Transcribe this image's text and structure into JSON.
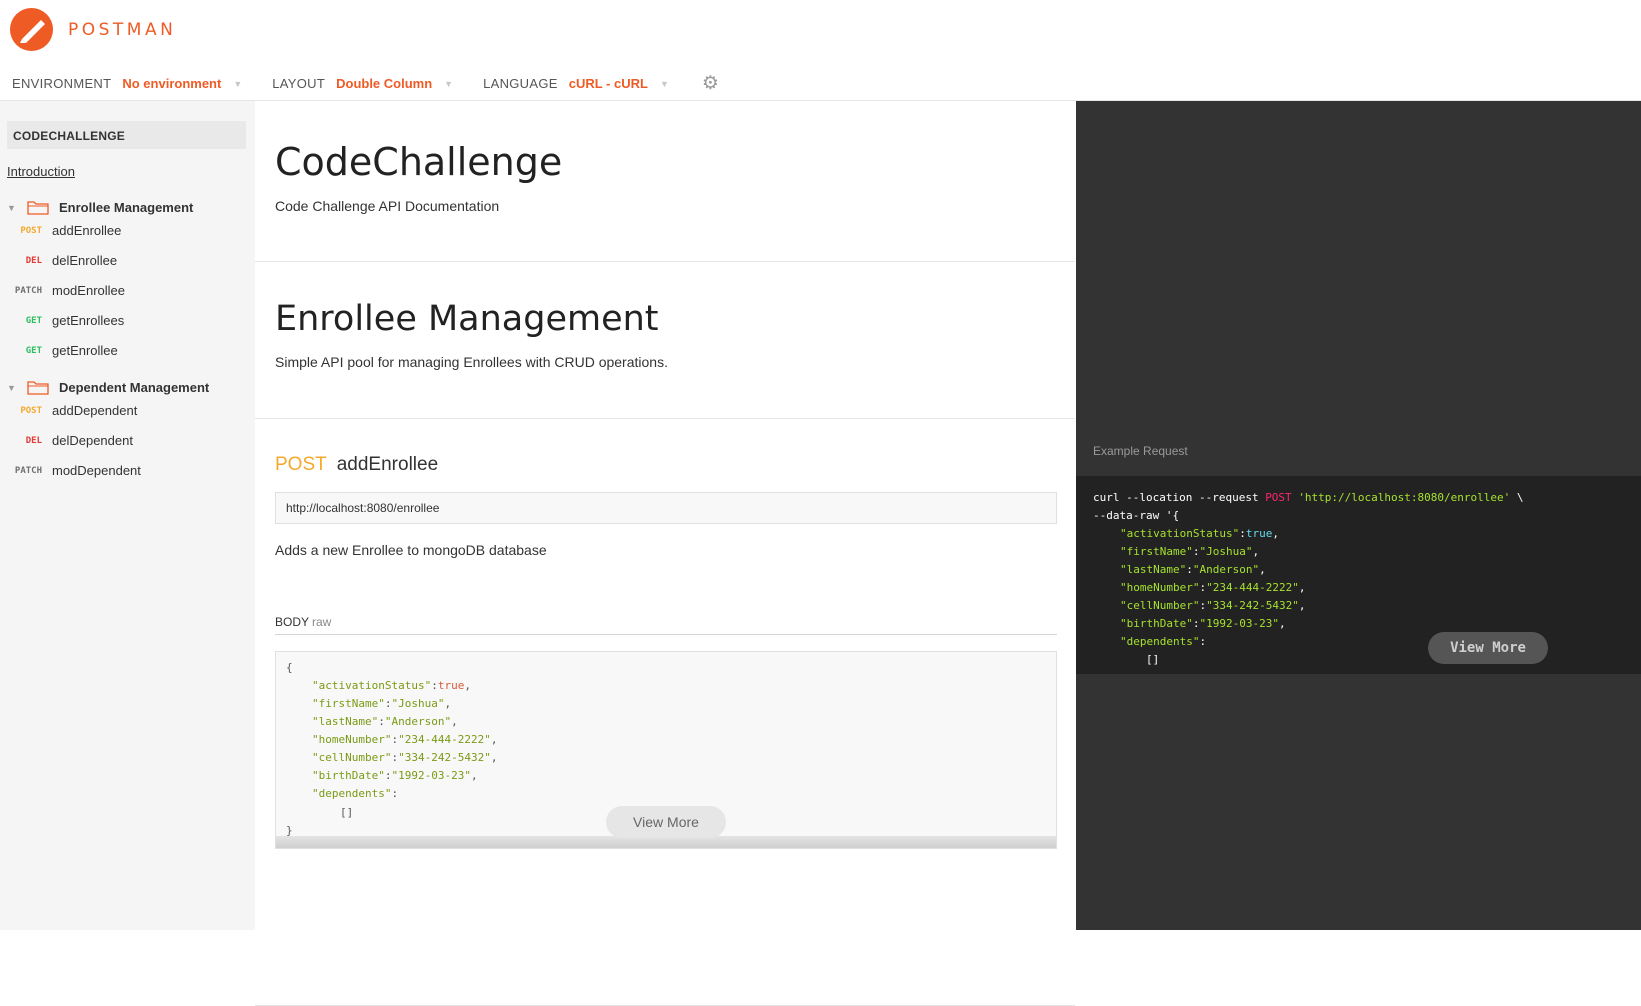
{
  "brand": {
    "name": "POSTMAN",
    "color": "#ef5b25"
  },
  "controls": {
    "environment": {
      "label": "ENVIRONMENT",
      "value": "No environment"
    },
    "layout": {
      "label": "LAYOUT",
      "value": "Double Column"
    },
    "language": {
      "label": "LANGUAGE",
      "value": "cURL - cURL"
    },
    "settings_icon": "gear-icon"
  },
  "sidebar": {
    "collection": "CODECHALLENGE",
    "intro": "Introduction",
    "folders": [
      {
        "name": "Enrollee Management",
        "requests": [
          {
            "method": "POST",
            "name": "addEnrollee"
          },
          {
            "method": "DEL",
            "name": "delEnrollee"
          },
          {
            "method": "PATCH",
            "name": "modEnrollee"
          },
          {
            "method": "GET",
            "name": "getEnrollees"
          },
          {
            "method": "GET",
            "name": "getEnrollee"
          }
        ]
      },
      {
        "name": "Dependent Management",
        "requests": [
          {
            "method": "POST",
            "name": "addDependent"
          },
          {
            "method": "DEL",
            "name": "delDependent"
          },
          {
            "method": "PATCH",
            "name": "modDependent"
          }
        ]
      }
    ]
  },
  "main": {
    "title": "CodeChallenge",
    "subtitle": "Code Challenge API Documentation",
    "folder_title": "Enrollee Management",
    "folder_desc": "Simple API pool for managing Enrollees with CRUD operations.",
    "request": {
      "method": "POST",
      "name": "addEnrollee",
      "url": "http://localhost:8080/enrollee",
      "description": "Adds a new Enrollee to mongoDB database",
      "body_label": "BODY",
      "body_mode": "raw",
      "view_more": "View More"
    }
  },
  "body_json": [
    {
      "key": "activationStatus",
      "value": "true",
      "type": "bool"
    },
    {
      "key": "firstName",
      "value": "Joshua",
      "type": "str"
    },
    {
      "key": "lastName",
      "value": "Anderson",
      "type": "str"
    },
    {
      "key": "homeNumber",
      "value": "234-444-2222",
      "type": "str"
    },
    {
      "key": "cellNumber",
      "value": "334-242-5432",
      "type": "str"
    },
    {
      "key": "birthDate",
      "value": "1992-03-23",
      "type": "str"
    },
    {
      "key": "dependents",
      "value": "[]",
      "type": "arr"
    }
  ],
  "example": {
    "label": "Example Request",
    "curl_prefix": "curl --location --request ",
    "curl_method": "POST",
    "curl_url": "'http://localhost:8080/enrollee'",
    "curl_suffix": " \\",
    "data_raw": "--data-raw '{",
    "view_more": "View More"
  },
  "colors": {
    "post": "#f4a92c",
    "del": "#e53935",
    "patch": "#707070",
    "get": "#2dbe60",
    "dark_panel": "#333333",
    "dark_code": "#222222"
  }
}
